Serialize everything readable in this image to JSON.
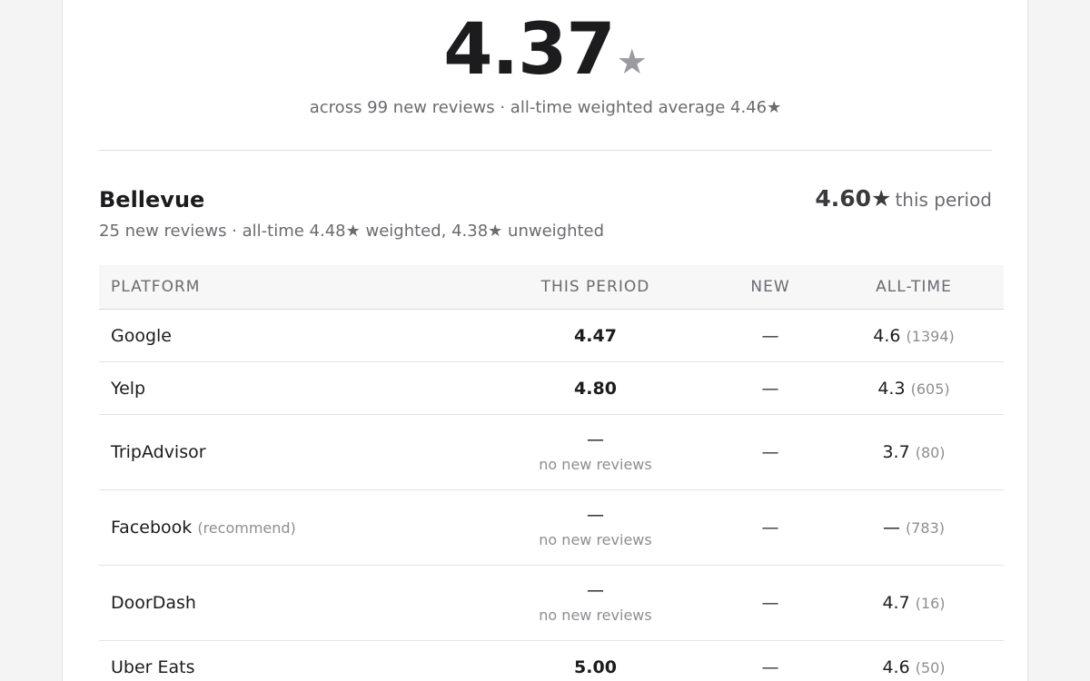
{
  "summary": {
    "rating": "4.37",
    "star": "★",
    "subtitle": "across 99 new reviews · all-time weighted average 4.46★"
  },
  "location": {
    "name": "Bellevue",
    "subtitle": "25 new reviews · all-time 4.48★ weighted, 4.38★ unweighted",
    "period_rating": "4.60★",
    "period_label": "this period"
  },
  "table": {
    "headers": {
      "platform": "PLATFORM",
      "period": "THIS PERIOD",
      "new": "NEW",
      "all_time": "ALL-TIME"
    },
    "rows": [
      {
        "platform": "Google",
        "note": "",
        "period": "4.47",
        "period_note": "",
        "new": "—",
        "all_time": "4.6",
        "count": "(1394)"
      },
      {
        "platform": "Yelp",
        "note": "",
        "period": "4.80",
        "period_note": "",
        "new": "—",
        "all_time": "4.3",
        "count": "(605)"
      },
      {
        "platform": "TripAdvisor",
        "note": "",
        "period": "—",
        "period_note": "no new reviews",
        "new": "—",
        "all_time": "3.7",
        "count": "(80)"
      },
      {
        "platform": "Facebook",
        "note": "(recommend)",
        "period": "—",
        "period_note": "no new reviews",
        "new": "—",
        "all_time": "—",
        "count": "(783)"
      },
      {
        "platform": "DoorDash",
        "note": "",
        "period": "—",
        "period_note": "no new reviews",
        "new": "—",
        "all_time": "4.7",
        "count": "(16)"
      },
      {
        "platform": "Uber Eats",
        "note": "",
        "period": "5.00",
        "period_note": "",
        "new": "—",
        "all_time": "4.6",
        "count": "(50)"
      }
    ]
  }
}
